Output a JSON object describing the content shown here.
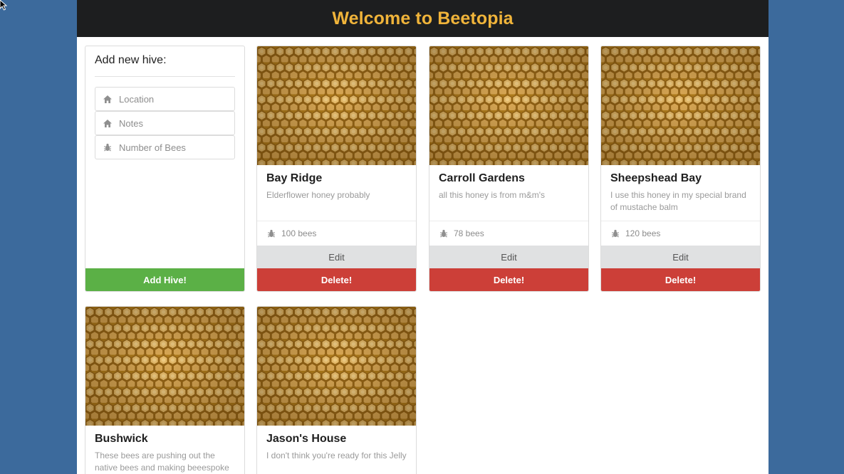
{
  "header": {
    "title": "Welcome to Beetopia"
  },
  "colors": {
    "background": "#3c6a9c",
    "header": "#1d1e1f",
    "title": "#f0b43a",
    "add": "#5bb046",
    "delete": "#cc3f38",
    "edit": "#e0e1e2"
  },
  "form": {
    "title": "Add new hive:",
    "fields": [
      {
        "placeholder": "Location",
        "icon": "home-icon"
      },
      {
        "placeholder": "Notes",
        "icon": "home-icon"
      },
      {
        "placeholder": "Number of Bees",
        "icon": "bug-icon"
      }
    ],
    "submit_label": "Add Hive!"
  },
  "hives": [
    {
      "name": "Bay Ridge",
      "notes": "Elderflower honey probably",
      "count": "100 bees"
    },
    {
      "name": "Carroll Gardens",
      "notes": "all this honey is from m&m's",
      "count": "78 bees"
    },
    {
      "name": "Sheepshead Bay",
      "notes": "I use this honey in my special brand of mustache balm",
      "count": "120 bees"
    },
    {
      "name": "Bushwick",
      "notes": "These bees are pushing out the native bees and making beeespoke",
      "count": ""
    },
    {
      "name": "Jason's House",
      "notes": "I don't think you're ready for this Jelly",
      "count": ""
    }
  ],
  "buttons": {
    "edit": "Edit",
    "delete": "Delete!"
  }
}
